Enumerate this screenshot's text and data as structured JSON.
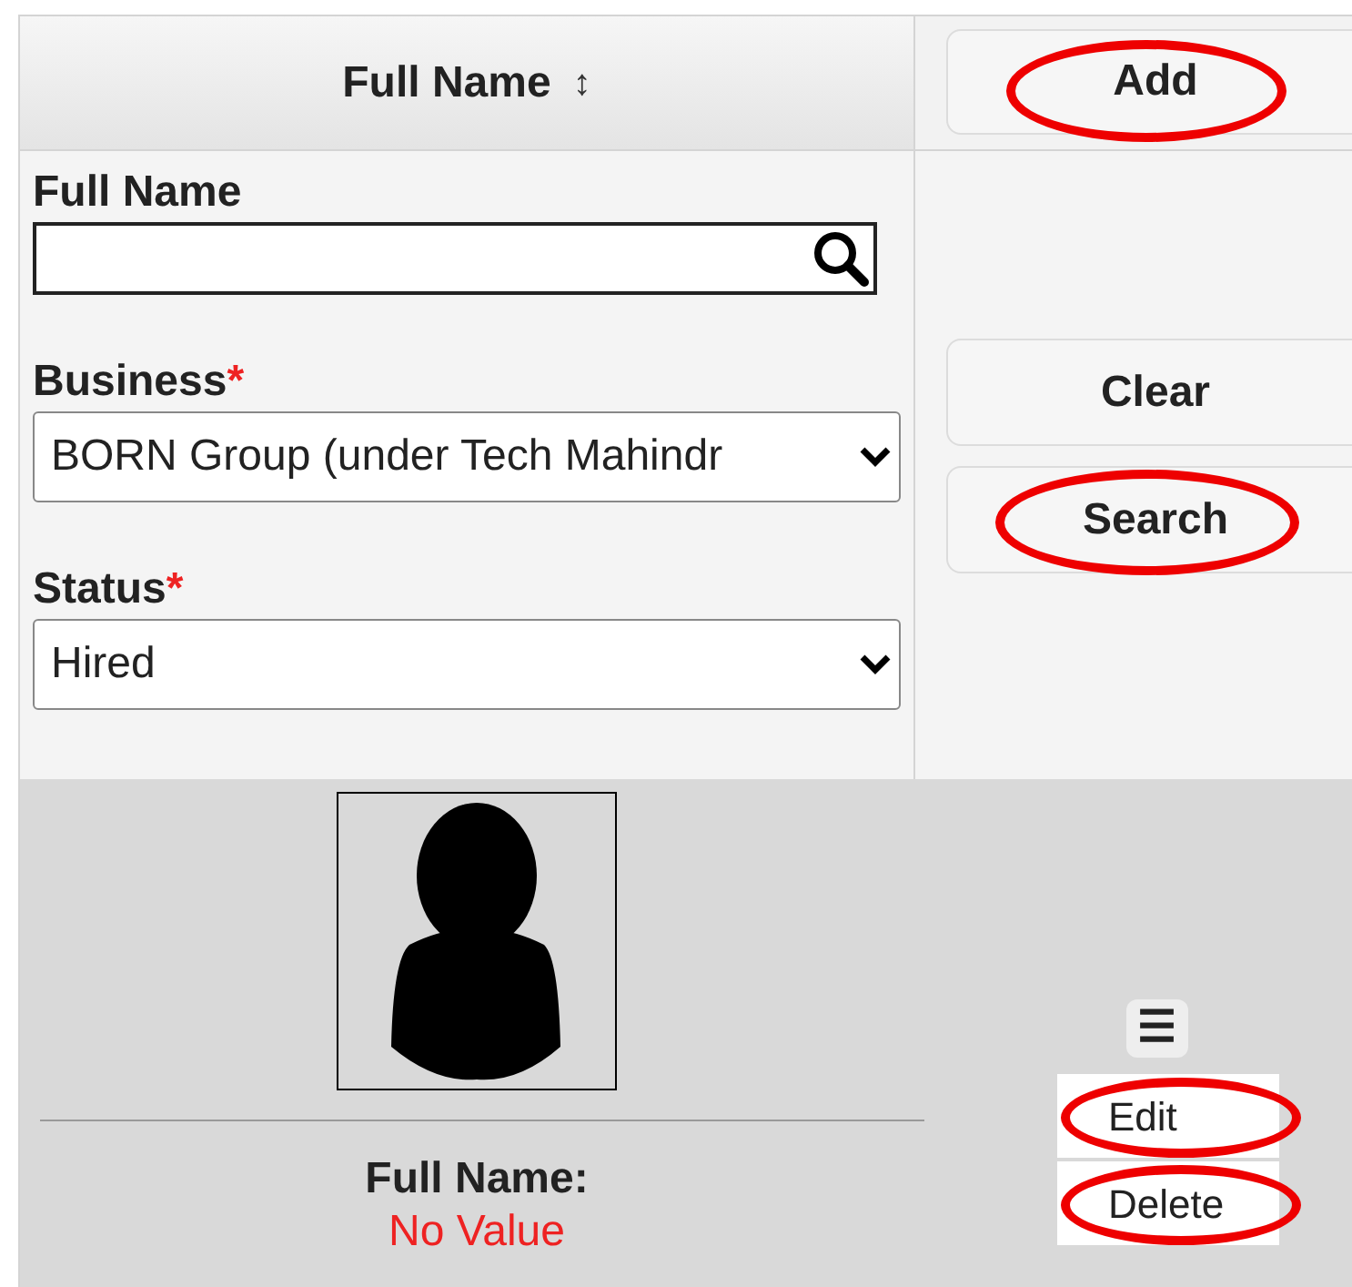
{
  "header": {
    "column_label": "Full Name",
    "sort_icon": "↕",
    "add_button": {
      "label": "Add",
      "highlighted": true
    }
  },
  "filters": [
    {
      "kind": "search",
      "label": "Full Name"
    },
    {
      "kind": "select",
      "label": "Business",
      "required_mark": "*",
      "value": "BORN Group (under Tech Mahindr"
    },
    {
      "kind": "select",
      "label": "Status",
      "required_mark": "*",
      "value": "Hired"
    }
  ],
  "filter_buttons": [
    {
      "label": "Clear",
      "highlighted": false
    },
    {
      "label": "Search",
      "highlighted": true
    }
  ],
  "record": {
    "field_label": "Full Name:",
    "field_value": "No Value",
    "menu_icon": "☰",
    "actions": [
      {
        "label": "Edit",
        "highlighted": true
      },
      {
        "label": "Delete",
        "highlighted": true
      }
    ]
  }
}
